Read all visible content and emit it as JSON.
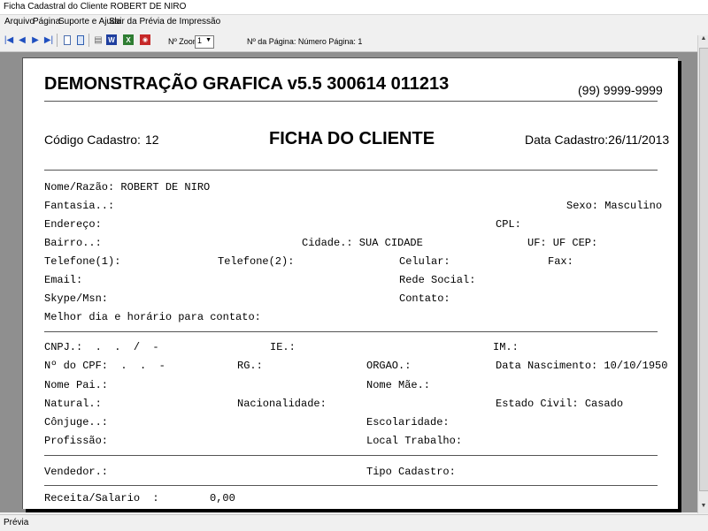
{
  "window": {
    "title": "Ficha Cadastral do Cliente ROBERT DE NIRO"
  },
  "menu": [
    "Arquivo",
    "Página",
    "Suporte e Ajuda",
    "Sair da Prévia de Impressão"
  ],
  "toolbar": {
    "icons": [
      "first-page-icon",
      "prev-page-icon",
      "next-page-icon",
      "last-page-icon",
      "single-page-icon",
      "two-page-icon",
      "printer-icon",
      "word-icon",
      "excel-icon",
      "pdf-icon"
    ],
    "zoom_label": "Nº Zoom",
    "zoom_value": "1",
    "page_info": "Nº da Página: Número Página: 1"
  },
  "report": {
    "company": "DEMONSTRAÇÃO GRAFICA v5.5 300614 011213",
    "phone": "(99) 9999-9999",
    "codigo_label": "Código Cadastro:",
    "codigo_value": "12",
    "heading": "FICHA DO CLIENTE",
    "data_cadastro": "Data Cadastro:26/11/2013",
    "fields": {
      "nome": "Nome/Razão: ROBERT DE NIRO",
      "fantasia": "Fantasia..:",
      "sexo": "Sexo: Masculino",
      "endereco": "Endereço:",
      "cpl": "CPL:",
      "bairro": "Bairro..:",
      "cidade": "Cidade.: SUA CIDADE",
      "uf_cep": "UF: UF CEP:",
      "telefone1": "Telefone(1):",
      "telefone2": "Telefone(2):",
      "celular": "Celular:",
      "fax": "Fax:",
      "email": "Email:",
      "rede_social": "Rede Social:",
      "skype": "Skype/Msn:",
      "contato": "Contato:",
      "melhor_dia": "Melhor dia e horário para contato:",
      "cnpj": "CNPJ.:  .  .  /  -",
      "ie": "IE.:",
      "im": "IM.:",
      "cpf": "Nº do CPF:  .  .  -",
      "rg": "RG.:",
      "orgao": "ORGAO.:",
      "nascimento": "Data Nascimento: 10/10/1950",
      "nome_pai": "Nome Pai.:",
      "nome_mae": "Nome Mãe.:",
      "natural": "Natural.:",
      "nacionalidade": "Nacionalidade:",
      "estado_civil": "Estado Civil: Casado",
      "conjuge": "Cônjuge..:",
      "escolaridade": "Escolaridade:",
      "profissao": "Profissão:",
      "local_trabalho": "Local Trabalho:",
      "vendedor": "Vendedor.:",
      "tipo_cadastro": "Tipo Cadastro:",
      "receita_label": "Receita/Salario  :",
      "receita_value": "0,00"
    }
  },
  "status": {
    "text": "Prévia"
  }
}
